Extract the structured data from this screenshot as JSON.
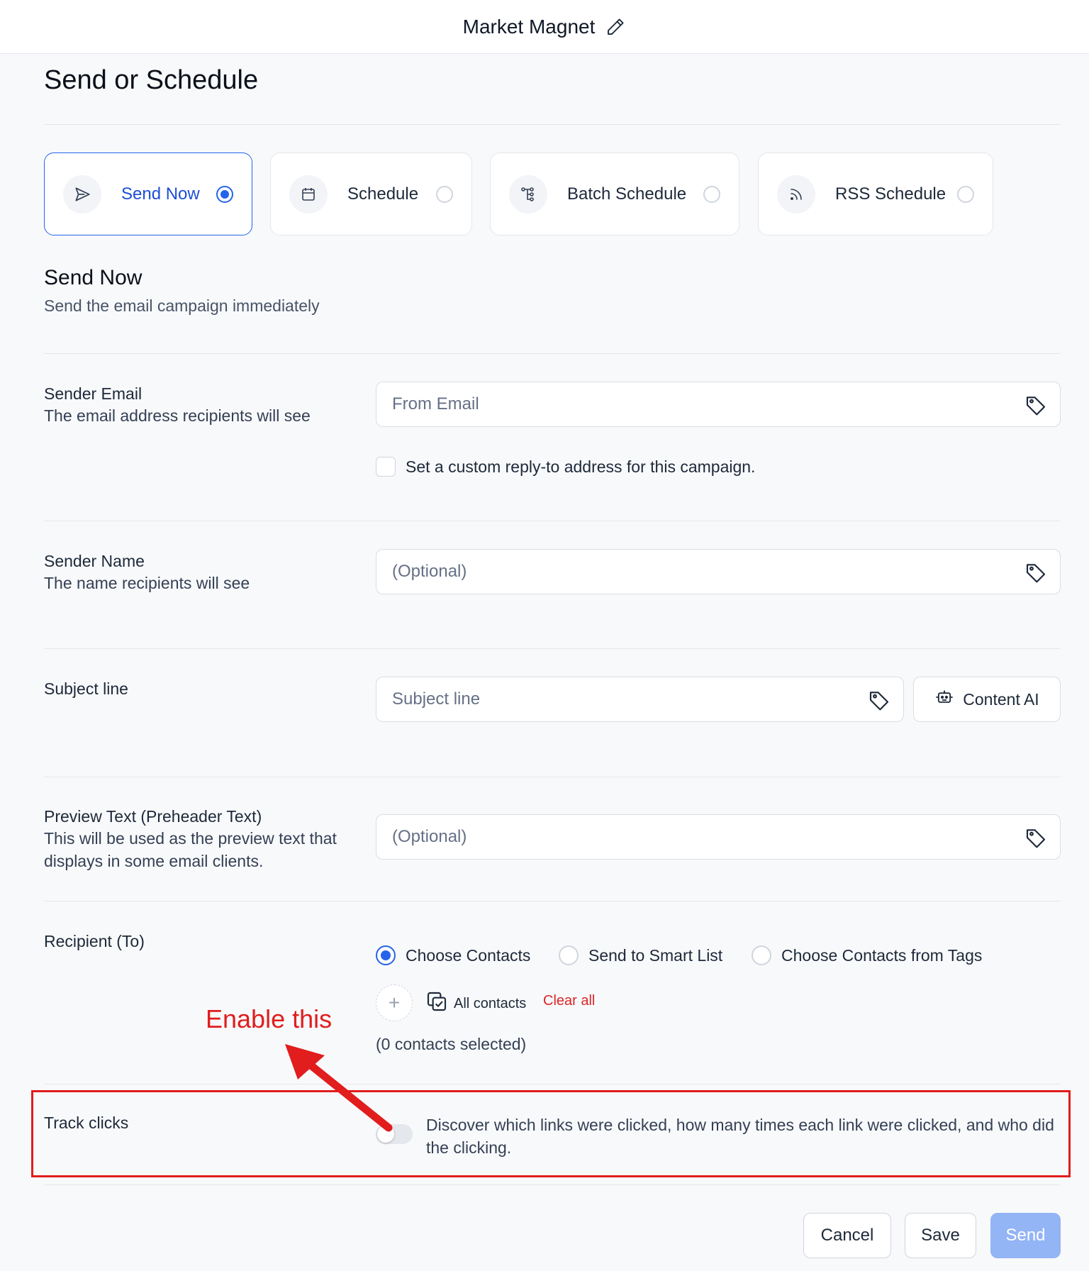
{
  "topbar": {
    "title": "Market Magnet",
    "edit_icon": "pencil-icon"
  },
  "page": {
    "title": "Send or Schedule"
  },
  "modes": [
    {
      "label": "Send Now",
      "icon": "send-icon",
      "selected": true
    },
    {
      "label": "Schedule",
      "icon": "calendar-icon",
      "selected": false
    },
    {
      "label": "Batch Schedule",
      "icon": "batch-tree-icon",
      "selected": false
    },
    {
      "label": "RSS Schedule",
      "icon": "rss-icon",
      "selected": false
    }
  ],
  "section": {
    "title": "Send Now",
    "description": "Send the email campaign immediately"
  },
  "sender_email": {
    "label": "Sender Email",
    "help": "The email address recipients will see",
    "placeholder": "From Email",
    "reply_to_label": "Set a custom reply-to address for this campaign.",
    "reply_to_checked": false
  },
  "sender_name": {
    "label": "Sender Name",
    "help": "The name recipients will see",
    "placeholder": "(Optional)"
  },
  "subject": {
    "label": "Subject line",
    "placeholder": "Subject line",
    "ai_button": "Content AI"
  },
  "preview_text": {
    "label": "Preview Text (Preheader Text)",
    "help": "This will be used as the preview text that displays in some email clients.",
    "placeholder": "(Optional)"
  },
  "recipient": {
    "label": "Recipient (To)",
    "options": [
      {
        "label": "Choose Contacts",
        "selected": true
      },
      {
        "label": "Send to Smart List",
        "selected": false
      },
      {
        "label": "Choose Contacts from Tags",
        "selected": false
      }
    ],
    "all_contacts": "All contacts",
    "clear_all": "Clear all",
    "count": "(0 contacts selected)"
  },
  "track_clicks": {
    "label": "Track clicks",
    "enabled": false,
    "description": "Discover which links were clicked, how many times each link were clicked, and who did the clicking."
  },
  "annotation": {
    "text": "Enable this",
    "color": "#e11d1d"
  },
  "actions": {
    "cancel": "Cancel",
    "save": "Save",
    "send": "Send"
  },
  "colors": {
    "accent": "#2563eb",
    "send_disabled": "#93b4f5",
    "annotation": "#e11d1d"
  }
}
